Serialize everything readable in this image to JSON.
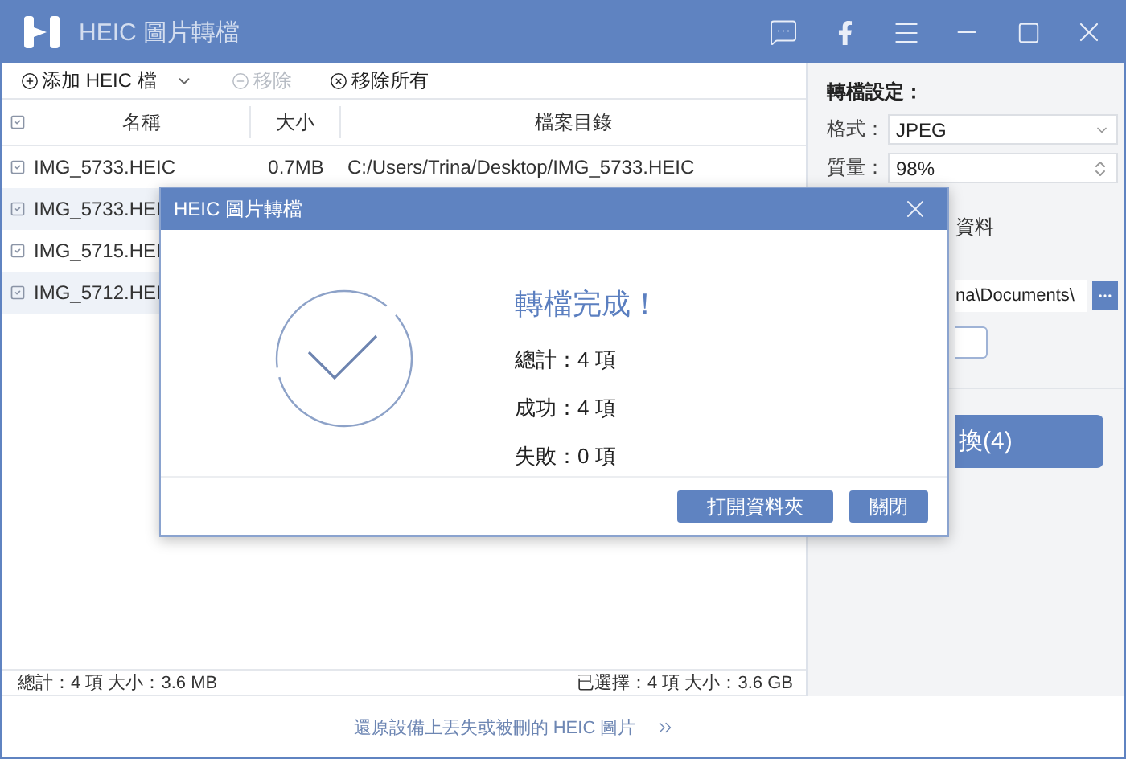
{
  "window": {
    "title": "HEIC 圖片轉檔"
  },
  "toolbar": [
    {
      "kind": "add",
      "label": "添加 HEIC 檔",
      "disabled": false,
      "has_menu": true
    },
    {
      "kind": "remove",
      "label": "移除",
      "disabled": true,
      "has_menu": false
    },
    {
      "kind": "clear",
      "label": "移除所有",
      "disabled": false,
      "has_menu": false
    }
  ],
  "table": {
    "select_all_checked": true,
    "columns": [
      "名稱",
      "大小",
      "檔案目錄"
    ],
    "rows": [
      {
        "name": "IMG_5733.HEIC",
        "size": "0.7MB",
        "path": "C:/Users/Trina/Desktop/IMG_5733.HEIC",
        "checked": true
      },
      {
        "name": "IMG_5733.HEI",
        "checked": true
      },
      {
        "name": "IMG_5715.HEI",
        "checked": true
      },
      {
        "name": "IMG_5712.HEI",
        "checked": true
      }
    ]
  },
  "status": {
    "total": "總計：4 項 大小：3.6 MB",
    "selected": "已選擇：4 項 大小：3.6 GB"
  },
  "settings": {
    "title": "轉檔設定：",
    "format": {
      "label": "格式：",
      "value": "JPEG"
    },
    "quality": {
      "label": "質量：",
      "value": "98%"
    },
    "option_fragment": "資料",
    "output_path": "na\\Documents\\",
    "convert_button": "換(4)"
  },
  "dialog": {
    "title": "HEIC 圖片轉檔",
    "heading": "轉檔完成！",
    "stats": [
      "總計：4 項",
      "成功：4 項",
      "失敗：0 項"
    ],
    "buttons": [
      "打開資料夾",
      "關閉"
    ]
  },
  "footer_link": "還原設備上丟失或被刪的 HEIC 圖片"
}
